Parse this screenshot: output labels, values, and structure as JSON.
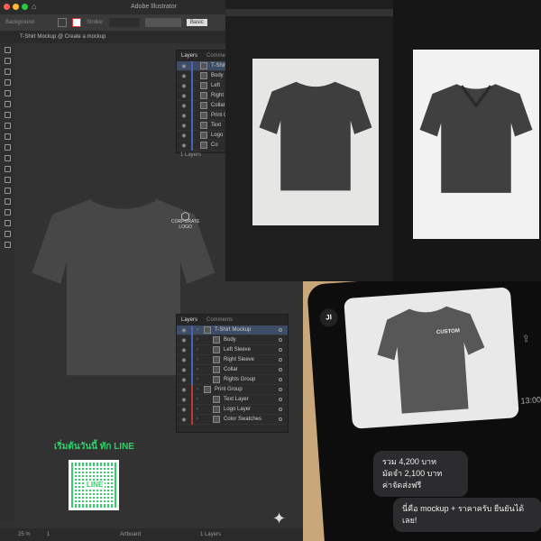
{
  "illustrator": {
    "app_title": "Adobe Illustrator",
    "control_bar": {
      "fill_label": "Background",
      "stroke_label": "Stroke:",
      "brush_label": "Basic"
    },
    "document_tab": "T-Shirt Mockup @ Create a mockup",
    "logo_text": [
      "CORPORATE",
      "LOGO"
    ],
    "cta_text": "เริ่มต้นวันนี้ ทัก LINE",
    "qr_label": "LINE",
    "status": {
      "zoom": "25 %",
      "page": "1",
      "tool": "Artboard",
      "layers_count": "1 Layers"
    },
    "small_panel": {
      "tabs": [
        "Layers",
        "Comments"
      ],
      "footer": "1 Layers",
      "rows": [
        "T-Shirt",
        "Body",
        "Left",
        "Right",
        "Collar",
        "Print G",
        "Text",
        "Logo",
        "Co"
      ]
    },
    "layers_panel": {
      "tabs": [
        "Layers",
        "Comments"
      ],
      "rows": [
        {
          "name": "T-Shirt Mockup",
          "selected": true
        },
        {
          "name": "Body"
        },
        {
          "name": "Left Sleeve"
        },
        {
          "name": "Right Sleeve"
        },
        {
          "name": "Collar"
        },
        {
          "name": "Rights Group"
        },
        {
          "name": "Print Group"
        },
        {
          "name": "Text Layer"
        },
        {
          "name": "Logo Layer"
        },
        {
          "name": "Color Swatches"
        }
      ]
    }
  },
  "chat": {
    "avatar": "JI",
    "print_text": "CUSTOM",
    "timestamp": "13:00",
    "message1": [
      "รวม 4,200 บาท",
      "มัดจำ 2,100 บาท",
      "ค่าจัดส่งฟรี"
    ],
    "message2": "นี่คือ mockup + ราคาครับ ยืนยันได้เลย!"
  },
  "colors": {
    "accent_line": "#2fd06a",
    "selection": "#3d4d66",
    "shirt": "#4a4a4a"
  }
}
